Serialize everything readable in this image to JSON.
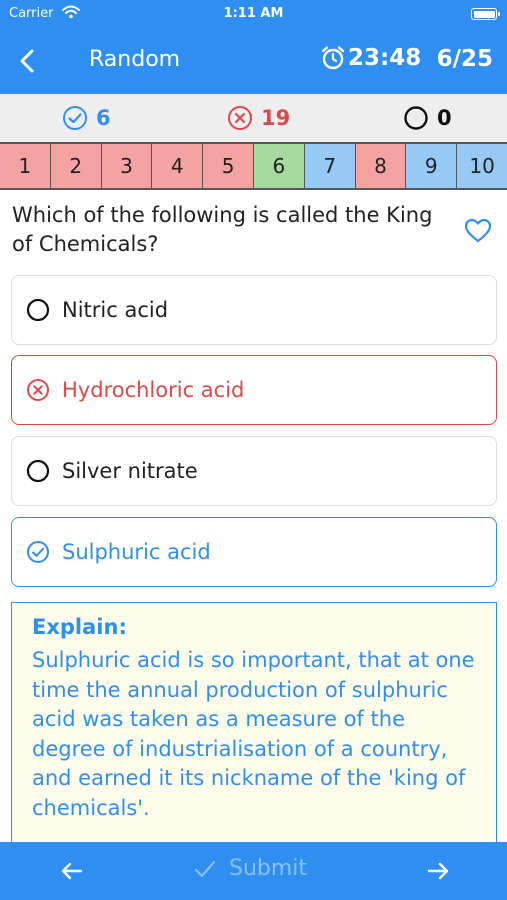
{
  "status_bar": {
    "carrier": "Carrier",
    "time": "1:11 AM"
  },
  "nav": {
    "title": "Random",
    "timer": "23:48",
    "progress": "6/25"
  },
  "scores": {
    "correct": "6",
    "wrong": "19",
    "unanswered": "0"
  },
  "question_nav": [
    {
      "num": "1",
      "state": "wrong"
    },
    {
      "num": "2",
      "state": "wrong"
    },
    {
      "num": "3",
      "state": "wrong"
    },
    {
      "num": "4",
      "state": "wrong"
    },
    {
      "num": "5",
      "state": "wrong"
    },
    {
      "num": "6",
      "state": "correct"
    },
    {
      "num": "7",
      "state": "unanswered"
    },
    {
      "num": "8",
      "state": "wrong"
    },
    {
      "num": "9",
      "state": "unanswered"
    },
    {
      "num": "10",
      "state": "unanswered"
    }
  ],
  "question": {
    "text": "Which of the following is called the King of Chemicals?"
  },
  "options": [
    {
      "label": "Nitric acid",
      "state": "neutral"
    },
    {
      "label": "Hydrochloric acid",
      "state": "wrong"
    },
    {
      "label": "Silver nitrate",
      "state": "neutral"
    },
    {
      "label": "Sulphuric acid",
      "state": "correct"
    }
  ],
  "explanation": {
    "heading": "Explain:",
    "text": "Sulphuric acid is so important, that at one time the annual production of sulphuric acid was taken as a measure of the degree of industrialisation of a country, and earned it its nickname of the 'king of chemicals'."
  },
  "bottom_bar": {
    "submit_label": "Submit"
  },
  "colors": {
    "primary": "#2f8ff0",
    "wrong": "#e04848",
    "correct_cell": "#a6d8a0",
    "wrong_cell": "#f4a2a2",
    "unanswered_cell": "#96caf5"
  }
}
